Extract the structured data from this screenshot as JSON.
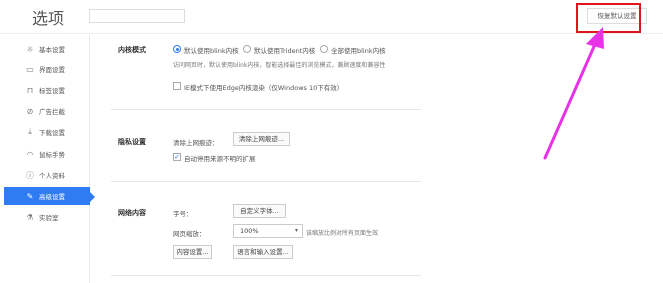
{
  "header": {
    "title": "选项",
    "search_value": "",
    "restore_label": "恢复默认设置"
  },
  "sidebar": {
    "items": [
      {
        "label": "基本设置",
        "icon": "gear-icon",
        "glyph": "☼"
      },
      {
        "label": "界面设置",
        "icon": "window-icon",
        "glyph": "▭"
      },
      {
        "label": "标签设置",
        "icon": "tab-icon",
        "glyph": "⊓"
      },
      {
        "label": "广告拦截",
        "icon": "block-icon",
        "glyph": "⊘"
      },
      {
        "label": "下载设置",
        "icon": "download-icon",
        "glyph": "⤓"
      },
      {
        "label": "鼠标手势",
        "icon": "mouse-icon",
        "glyph": "◠"
      },
      {
        "label": "个人资料",
        "icon": "user-icon",
        "glyph": "ⓘ"
      },
      {
        "label": "高级设置",
        "icon": "advanced-icon",
        "glyph": "✎"
      },
      {
        "label": "实验室",
        "icon": "lab-icon",
        "glyph": "⚗"
      }
    ],
    "active_index": 7,
    "accent": "#2f7bf2"
  },
  "kernel": {
    "label": "内核模式",
    "options": [
      "默认使用blink内核",
      "默认使用Trident内核",
      "全部使用blink内核"
    ],
    "selected": 0,
    "hint": "访问网页时，默认使用blink内核，智能选择最佳的浏览模式，兼顾速度和兼容性",
    "ie_checkbox": "IE模式下使用Edge内核渲染（仅Windows 10下有效）"
  },
  "privacy": {
    "label": "隐私设置",
    "clear_label": "清除上网痕迹：",
    "clear_button": "清除上网痕迹...",
    "auto_disable": "自动停用来源不明的扩展"
  },
  "web_content": {
    "label": "网络内容",
    "font_label": "字号：",
    "font_button": "自定义字体...",
    "zoom_label": "网页缩放：",
    "zoom_value": "100%",
    "zoom_hint": "该缩放比例对所有页面生效",
    "content_button": "内容设置...",
    "lang_button": "语言和输入设置..."
  },
  "annotation_color": "#e0151a",
  "arrow_color": "#e832e8"
}
